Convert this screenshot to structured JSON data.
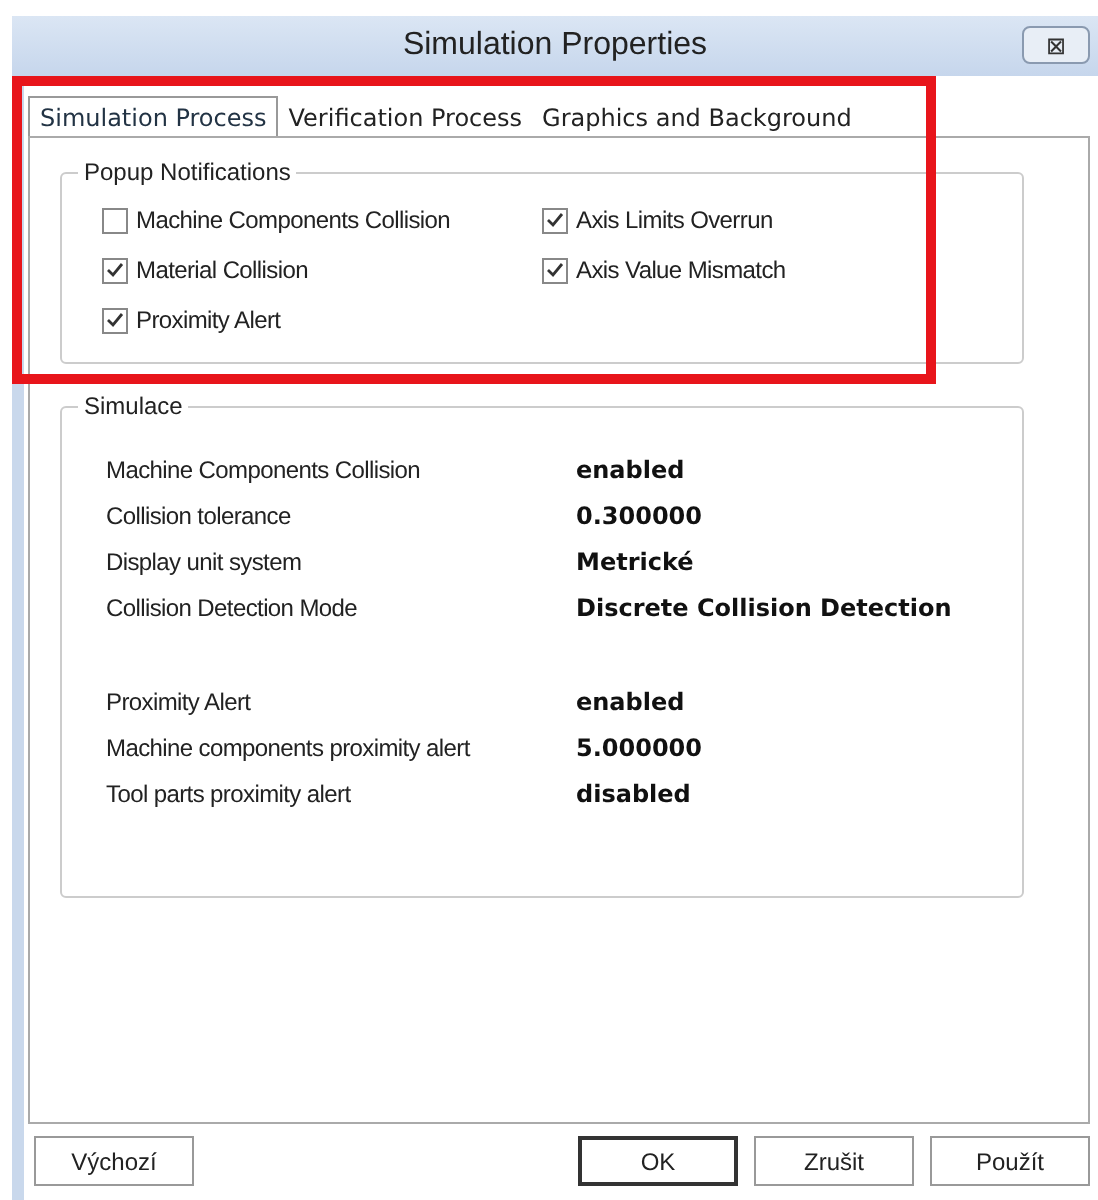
{
  "window": {
    "title": "Simulation Properties",
    "close": "⊠"
  },
  "tabs": [
    {
      "label": "Simulation Process",
      "selected": true
    },
    {
      "label": "Verification Process",
      "selected": false
    },
    {
      "label": "Graphics and Background",
      "selected": false
    }
  ],
  "popup_notifications": {
    "title": "Popup Notifications",
    "items": [
      {
        "label": "Machine Components Collision",
        "checked": false
      },
      {
        "label": "Axis Limits Overrun",
        "checked": true
      },
      {
        "label": "Material Collision",
        "checked": true
      },
      {
        "label": "Axis Value Mismatch",
        "checked": true
      },
      {
        "label": "Proximity Alert",
        "checked": true
      }
    ]
  },
  "simulace": {
    "title": "Simulace",
    "groups": [
      [
        {
          "label": "Machine Components Collision",
          "value": "enabled"
        },
        {
          "label": "Collision tolerance",
          "value": "0.300000"
        },
        {
          "label": "Display unit system",
          "value": "Metrické"
        },
        {
          "label": "Collision Detection Mode",
          "value": "Discrete Collision Detection"
        }
      ],
      [
        {
          "label": "Proximity Alert",
          "value": "enabled"
        },
        {
          "label": "Machine components proximity alert",
          "value": "5.000000"
        },
        {
          "label": "Tool parts proximity alert",
          "value": "disabled"
        }
      ]
    ]
  },
  "buttons": [
    {
      "label": "Výchozí",
      "default": false
    },
    {
      "label": "OK",
      "default": true
    },
    {
      "label": "Zrušit",
      "default": false
    },
    {
      "label": "Použít",
      "default": false
    }
  ]
}
